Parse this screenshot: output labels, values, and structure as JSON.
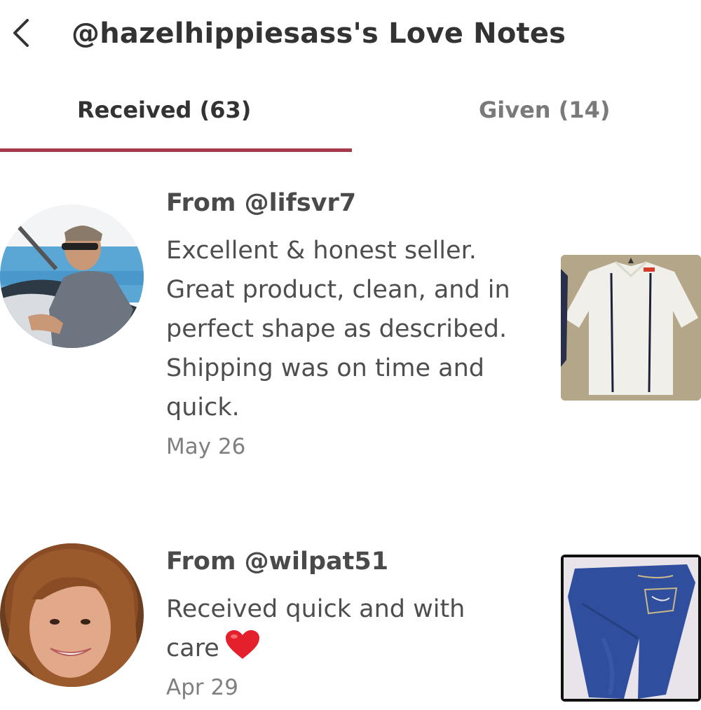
{
  "header": {
    "back_icon": "chevron-left-icon",
    "title": "@hazelhippiesass's Love Notes"
  },
  "tabs": [
    {
      "label": "Received (63)",
      "active": true
    },
    {
      "label": "Given (14)",
      "active": false
    }
  ],
  "accent_color": "#a63a4a",
  "notes": [
    {
      "from": "From @lifsvr7",
      "text": "Excellent & honest seller. Great product, clean, and in perfect shape as described. Shipping was on time and quick.",
      "date": "May 26",
      "avatar": "man-on-boat-avatar",
      "thumbnail": "white-shirt-thumbnail"
    },
    {
      "from": "From @wilpat51",
      "text": "Received quick and with care",
      "emoji": "heart-icon",
      "date": "Apr 29",
      "avatar": "woman-smiling-avatar",
      "thumbnail": "blue-jeans-thumbnail"
    }
  ]
}
